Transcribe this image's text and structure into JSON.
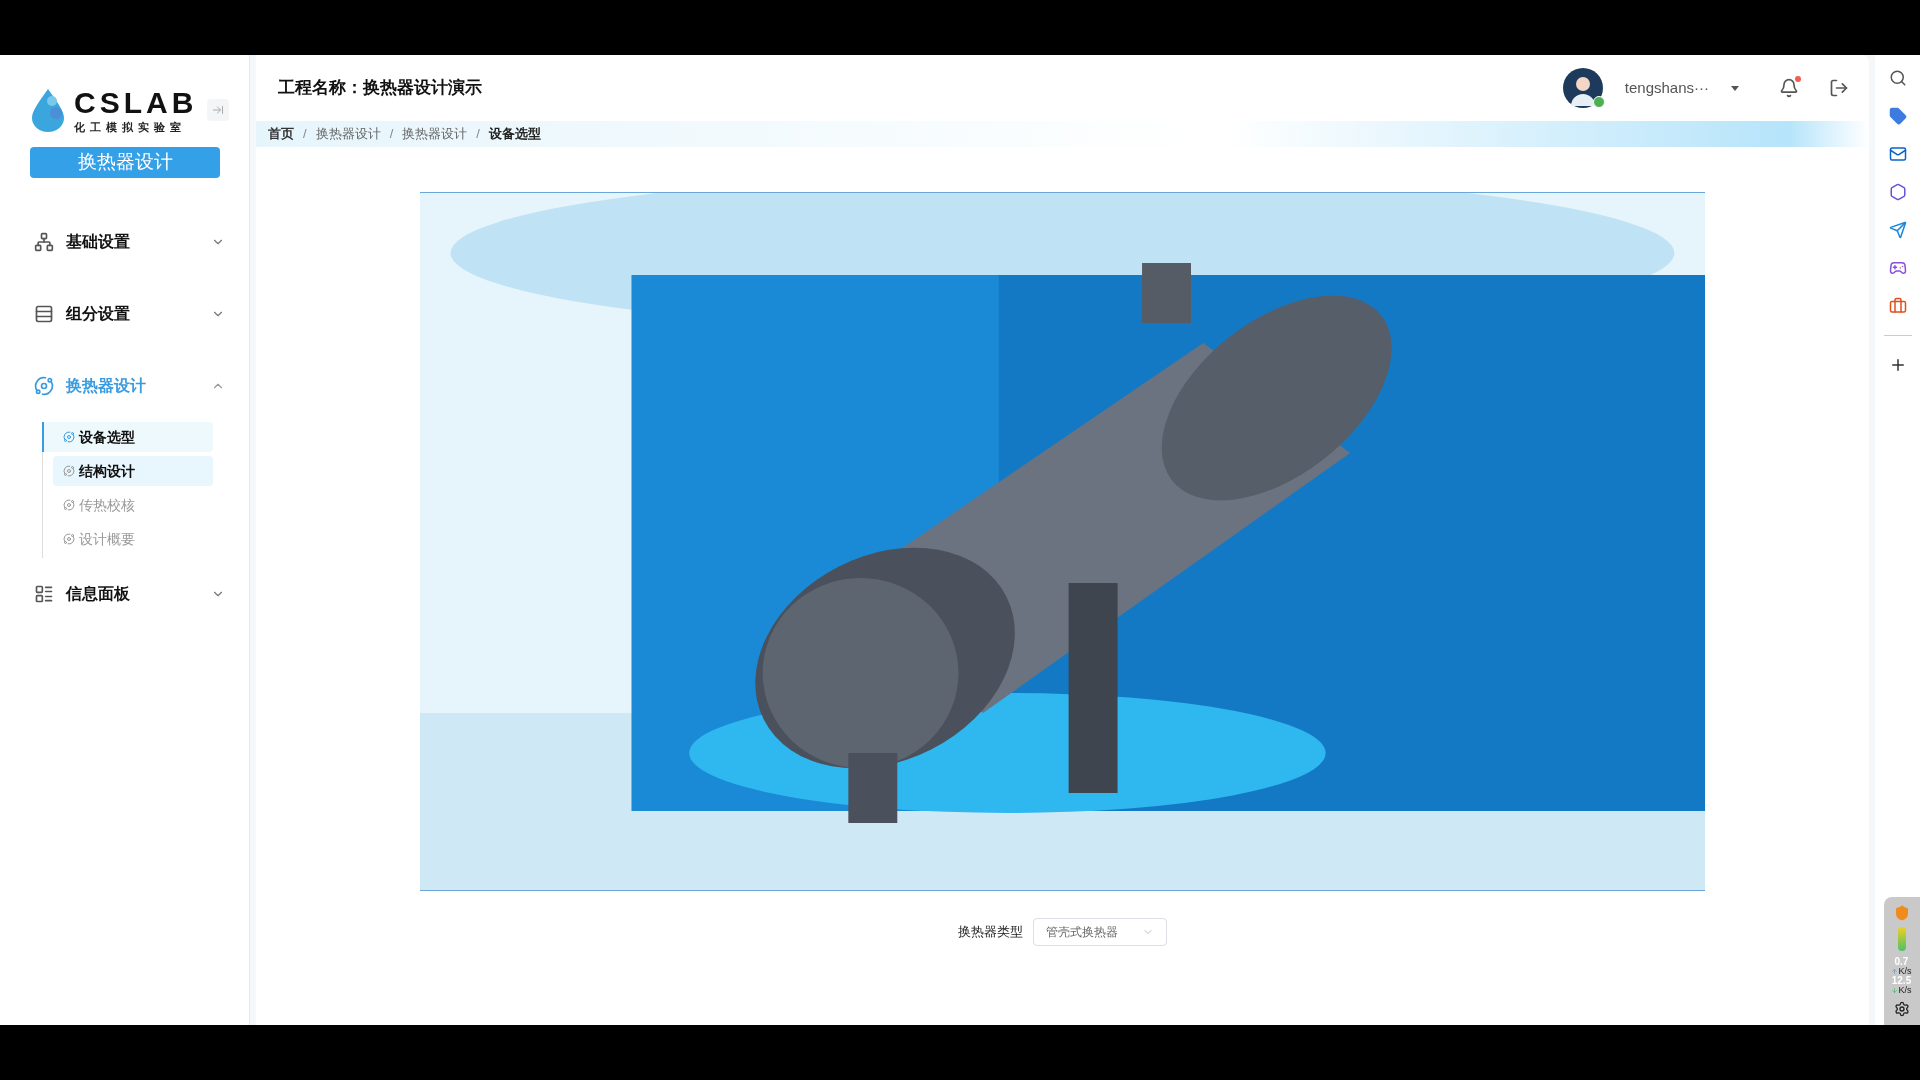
{
  "sidebar": {
    "logo": {
      "title": "CSLAB",
      "subtitle": "化工模拟实验室"
    },
    "module_button": "换热器设计",
    "menu": [
      {
        "label": "基础设置",
        "expanded": false,
        "selected": false
      },
      {
        "label": "组分设置",
        "expanded": false,
        "selected": false
      },
      {
        "label": "换热器设计",
        "expanded": true,
        "selected": true,
        "children": [
          {
            "label": "设备选型",
            "selected": true,
            "hovered": false
          },
          {
            "label": "结构设计",
            "selected": false,
            "hovered": true
          },
          {
            "label": "传热校核",
            "selected": false,
            "hovered": false
          },
          {
            "label": "设计概要",
            "selected": false,
            "hovered": false
          }
        ]
      },
      {
        "label": "信息面板",
        "expanded": false,
        "selected": false
      }
    ]
  },
  "header": {
    "project_title": "工程名称：换热器设计演示",
    "user": {
      "name": "tengshans···",
      "online": true
    },
    "notifications": {
      "unread": true
    }
  },
  "breadcrumb": {
    "separator": "/",
    "items": [
      {
        "label": "首页",
        "current": false
      },
      {
        "label": "换热器设计",
        "current": false
      },
      {
        "label": "换热器设计",
        "current": false
      },
      {
        "label": "设备选型",
        "current": true
      }
    ]
  },
  "main": {
    "field": {
      "label": "换热器类型",
      "value": "管壳式换热器"
    }
  },
  "right_bar": {
    "up_speed": "0.7",
    "up_unit": "K/s",
    "down_speed": "12.5",
    "down_unit": "K/s"
  }
}
